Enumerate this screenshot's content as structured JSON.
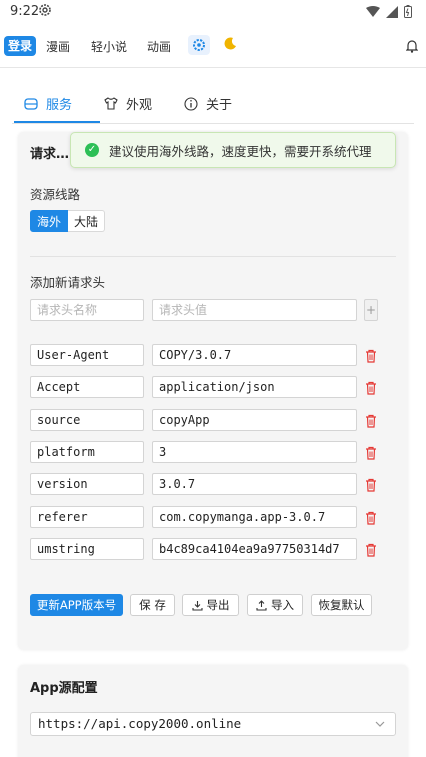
{
  "status": {
    "time": "9:22"
  },
  "nav": {
    "login": "登录",
    "items": [
      "漫画",
      "轻小说",
      "动画"
    ]
  },
  "tabs": [
    {
      "label": "服务",
      "icon": "server-icon",
      "active": true
    },
    {
      "label": "外观",
      "icon": "shirt-icon",
      "active": false
    },
    {
      "label": "关于",
      "icon": "info-icon",
      "active": false
    }
  ],
  "toast": {
    "text": "建议使用海外线路，速度更快，需要开系统代理"
  },
  "request_card": {
    "title": "请求…",
    "route_label": "资源线路",
    "routes": [
      "海外",
      "大陆"
    ],
    "selected_route": "海外",
    "add_header_label": "添加新请求头",
    "key_placeholder": "请求头名称",
    "value_placeholder": "请求头值",
    "headers": [
      {
        "key": "User-Agent",
        "value": "COPY/3.0.7"
      },
      {
        "key": "Accept",
        "value": "application/json"
      },
      {
        "key": "source",
        "value": "copyApp"
      },
      {
        "key": "platform",
        "value": "3"
      },
      {
        "key": "version",
        "value": "3.0.7"
      },
      {
        "key": "referer",
        "value": "com.copymanga.app-3.0.7"
      },
      {
        "key": "umstring",
        "value": "b4c89ca4104ea9a97750314d7"
      }
    ],
    "buttons": {
      "update_version": "更新APP版本号",
      "save": "保 存",
      "export": "导出",
      "import": "导入",
      "restore": "恢复默认"
    }
  },
  "app_source_card": {
    "title": "App源配置",
    "selected": "https://api.copy2000.online"
  },
  "colors": {
    "accent": "#1e88e5",
    "danger": "#e53935",
    "success": "#2dbf56"
  }
}
